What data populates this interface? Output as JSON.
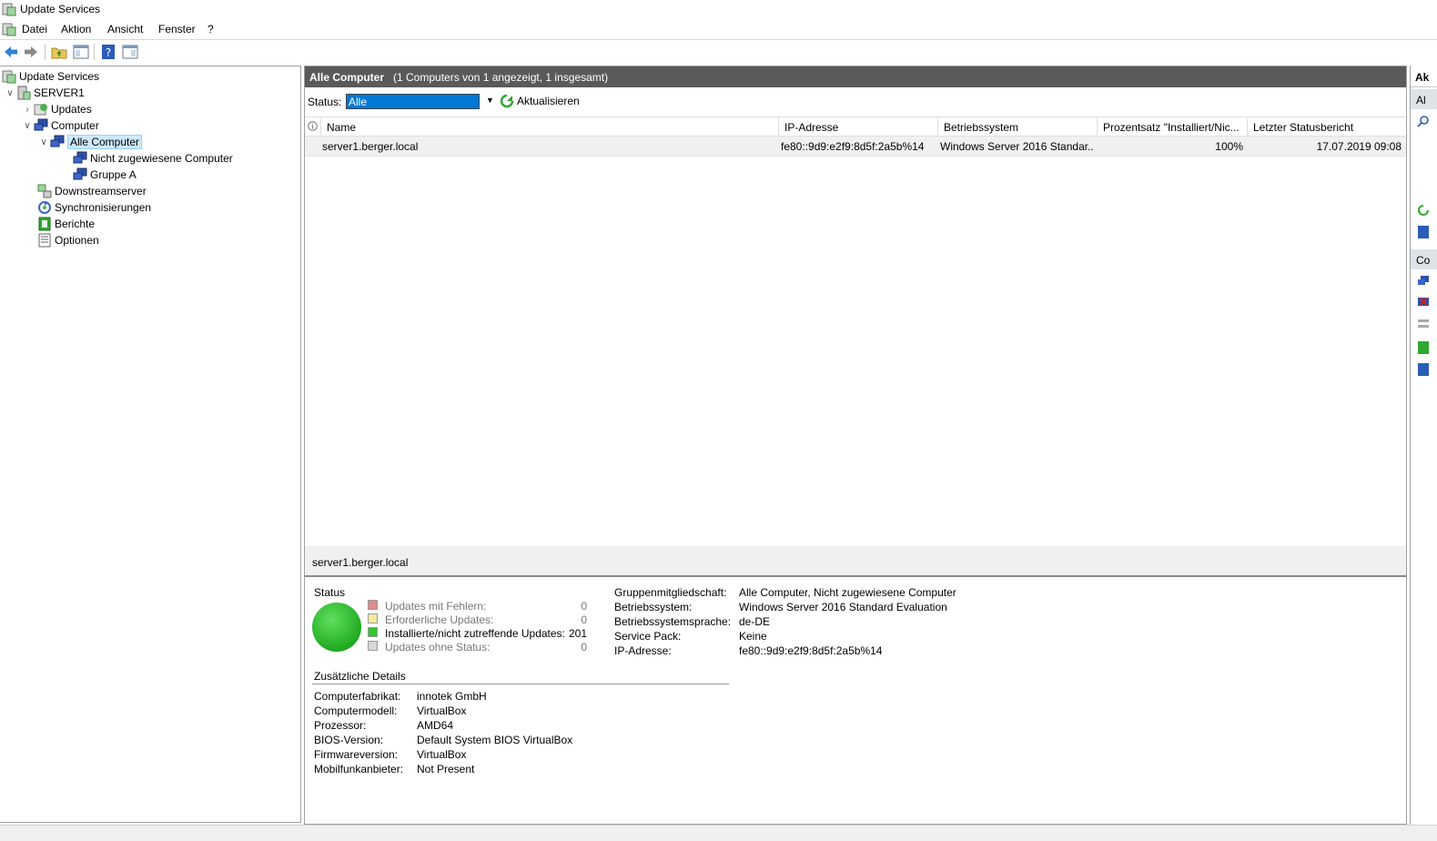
{
  "window": {
    "title": "Update Services"
  },
  "menu": {
    "items": [
      "Datei",
      "Aktion",
      "Ansicht",
      "Fenster",
      "?"
    ]
  },
  "tree": {
    "root": "Update Services",
    "server": "SERVER1",
    "updates": "Updates",
    "computer": "Computer",
    "all_computers": "Alle Computer",
    "unassigned": "Nicht zugewiesene Computer",
    "group_a": "Gruppe A",
    "downstream": "Downstreamserver",
    "sync": "Synchronisierungen",
    "reports": "Berichte",
    "options": "Optionen"
  },
  "main": {
    "title": "Alle Computer",
    "subtitle": "(1 Computers von 1 angezeigt, 1 insgesamt)",
    "status_label": "Status:",
    "status_value": "Alle",
    "refresh_label": "Aktualisieren",
    "columns": [
      "Name",
      "IP-Adresse",
      "Betriebssystem",
      "Prozentsatz \"Installiert/Nic...",
      "Letzter Statusbericht"
    ],
    "rows": [
      {
        "name": "server1.berger.local",
        "ip": "fe80::9d9:e2f9:8d5f:2a5b%14",
        "os": "Windows Server 2016 Standar...",
        "percent": "100%",
        "last_report": "17.07.2019 09:08"
      }
    ]
  },
  "details": {
    "selected_name": "server1.berger.local",
    "status_heading": "Status",
    "legend": [
      {
        "label": "Updates mit Fehlern:",
        "count": "0",
        "color": "#e08a8a",
        "muted": true
      },
      {
        "label": "Erforderliche Updates:",
        "count": "0",
        "color": "#f5eba0",
        "muted": true
      },
      {
        "label": "Installierte/nicht zutreffende Updates:",
        "count": "201",
        "color": "#33c433",
        "muted": false
      },
      {
        "label": "Updates ohne Status:",
        "count": "0",
        "color": "#d8d8d8",
        "muted": true
      }
    ],
    "props": [
      {
        "label": "Gruppenmitgliedschaft:",
        "value": "Alle Computer, Nicht zugewiesene Computer"
      },
      {
        "label": "Betriebssystem:",
        "value": "Windows Server 2016 Standard Evaluation"
      },
      {
        "label": "Betriebssystemsprache:",
        "value": "de-DE"
      },
      {
        "label": "Service Pack:",
        "value": "Keine"
      },
      {
        "label": "IP-Adresse:",
        "value": "fe80::9d9:e2f9:8d5f:2a5b%14"
      }
    ],
    "extra_heading": "Zusätzliche Details",
    "extra": [
      {
        "label": "Computerfabrikat:",
        "value": "innotek GmbH"
      },
      {
        "label": "Computermodell:",
        "value": "VirtualBox"
      },
      {
        "label": "Prozessor:",
        "value": "AMD64"
      },
      {
        "label": "BIOS-Version:",
        "value": "Default System BIOS VirtualBox"
      },
      {
        "label": "Firmwareversion:",
        "value": "VirtualBox"
      },
      {
        "label": "Mobilfunkanbieter:",
        "value": "Not Present"
      }
    ]
  },
  "actions": {
    "header": "Ak",
    "section1": "Al",
    "section2": "Co"
  },
  "colors": {
    "status_ok": "#2fbf2f",
    "header_bg": "#5a5a5a",
    "selection": "#0078d7"
  }
}
